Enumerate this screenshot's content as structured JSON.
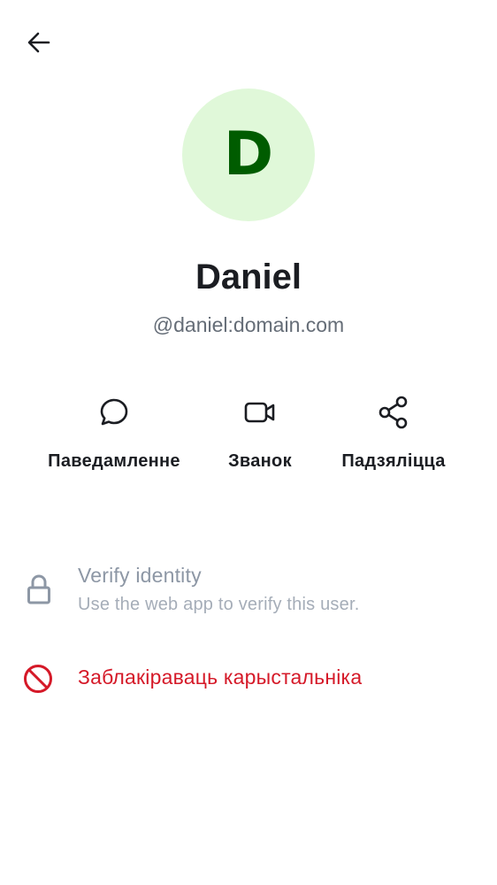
{
  "header": {
    "back_icon": "arrow-left-icon"
  },
  "profile": {
    "avatar_initial": "D",
    "display_name": "Daniel",
    "user_id": "@daniel:domain.com",
    "avatar_bg_color": "#e0f8d9",
    "avatar_text_color": "#005c00"
  },
  "actions": [
    {
      "label": "Паведамленне",
      "icon": "chat-bubble-icon"
    },
    {
      "label": "Званок",
      "icon": "video-camera-icon"
    },
    {
      "label": "Падзяліцца",
      "icon": "share-icon"
    }
  ],
  "verify": {
    "title": "Verify identity",
    "subtitle": "Use the web app to verify this user.",
    "icon": "lock-icon"
  },
  "block": {
    "label": "Заблакіраваць карыстальніка",
    "icon": "block-icon",
    "color": "#d51928"
  }
}
